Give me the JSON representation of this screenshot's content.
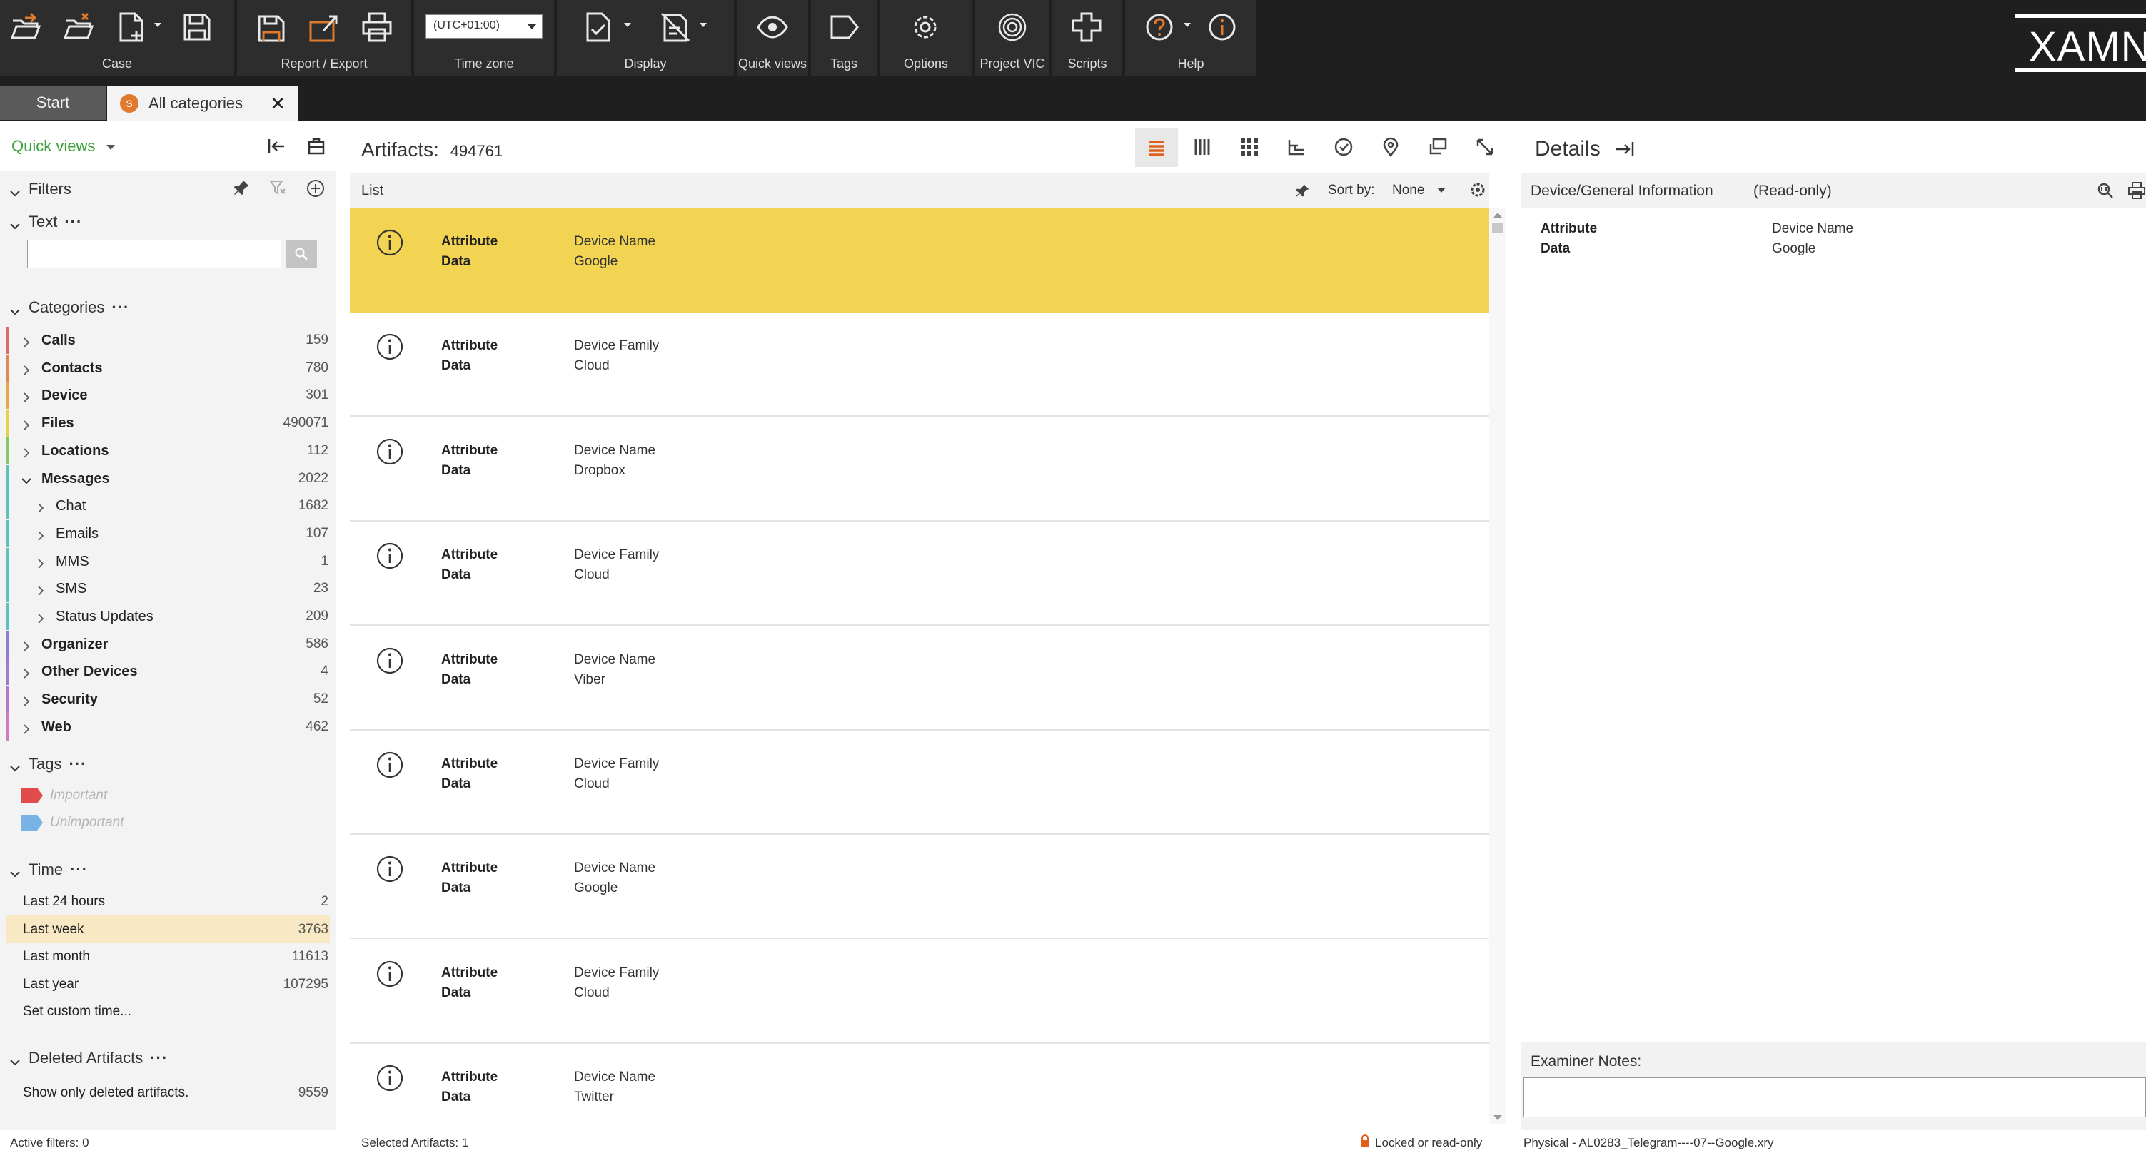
{
  "ribbon": {
    "groups": {
      "case": "Case",
      "report_export": "Report / Export",
      "time_zone": "Time zone",
      "display": "Display",
      "quick_views": "Quick views",
      "tags": "Tags",
      "options": "Options",
      "project_vic": "Project VIC",
      "scripts": "Scripts",
      "help": "Help"
    },
    "timezone_value": "(UTC+01:00)",
    "logo": "XAMN"
  },
  "tabs": {
    "start": "Start",
    "active": "All categories",
    "active_icon_text": "S",
    "close": "✕"
  },
  "left": {
    "quick_views": "Quick views",
    "filters": "Filters",
    "text_section": "Text",
    "search_placeholder": "",
    "categories_title": "Categories",
    "categories": [
      {
        "name": "Calls",
        "count": "159",
        "bold": true,
        "color": "#e06a6a"
      },
      {
        "name": "Contacts",
        "count": "780",
        "bold": true,
        "color": "#e3894f"
      },
      {
        "name": "Device",
        "count": "301",
        "bold": true,
        "color": "#e7a84c"
      },
      {
        "name": "Files",
        "count": "490071",
        "bold": true,
        "color": "#e8d04c"
      },
      {
        "name": "Locations",
        "count": "112",
        "bold": true,
        "color": "#86c76a"
      },
      {
        "name": "Messages",
        "count": "2022",
        "bold": true,
        "color": "#5fc0c0",
        "expanded": true
      },
      {
        "name": "Chat",
        "count": "1682",
        "bold": false,
        "color": "#5fc0c0",
        "child": true
      },
      {
        "name": "Emails",
        "count": "107",
        "bold": false,
        "color": "#5fc0c0",
        "child": true
      },
      {
        "name": "MMS",
        "count": "1",
        "bold": false,
        "color": "#5fc0c0",
        "child": true
      },
      {
        "name": "SMS",
        "count": "23",
        "bold": false,
        "color": "#5fc0c0",
        "child": true
      },
      {
        "name": "Status Updates",
        "count": "209",
        "bold": false,
        "color": "#5fc0c0",
        "child": true
      },
      {
        "name": "Organizer",
        "count": "586",
        "bold": true,
        "color": "#8a7fd6"
      },
      {
        "name": "Other Devices",
        "count": "4",
        "bold": true,
        "color": "#9f7ad0"
      },
      {
        "name": "Security",
        "count": "52",
        "bold": true,
        "color": "#b874cf"
      },
      {
        "name": "Web",
        "count": "462",
        "bold": true,
        "color": "#d47ac4"
      }
    ],
    "tags_title": "Tags",
    "tags": [
      {
        "name": "Important",
        "color": "#e24b4b"
      },
      {
        "name": "Unimportant",
        "color": "#79b3e6"
      }
    ],
    "time_title": "Time",
    "time": [
      {
        "name": "Last 24 hours",
        "count": "2"
      },
      {
        "name": "Last week",
        "count": "3763",
        "highlight": true
      },
      {
        "name": "Last month",
        "count": "11613"
      },
      {
        "name": "Last year",
        "count": "107295"
      },
      {
        "name": "Set custom time...",
        "count": ""
      }
    ],
    "deleted_title": "Deleted Artifacts",
    "deleted_option": "Show only deleted artifacts.",
    "deleted_count": "9559"
  },
  "center": {
    "artifacts_label": "Artifacts:",
    "artifacts_count": "494761",
    "list_label": "List",
    "sort_label": "Sort by:",
    "sort_value": "None",
    "rows": [
      {
        "k1": "Attribute",
        "k2": "Data",
        "v1": "Device Name",
        "v2": "Google",
        "selected": true
      },
      {
        "k1": "Attribute",
        "k2": "Data",
        "v1": "Device Family",
        "v2": "Cloud"
      },
      {
        "k1": "Attribute",
        "k2": "Data",
        "v1": "Device Name",
        "v2": "Dropbox"
      },
      {
        "k1": "Attribute",
        "k2": "Data",
        "v1": "Device Family",
        "v2": "Cloud"
      },
      {
        "k1": "Attribute",
        "k2": "Data",
        "v1": "Device Name",
        "v2": "Viber"
      },
      {
        "k1": "Attribute",
        "k2": "Data",
        "v1": "Device Family",
        "v2": "Cloud"
      },
      {
        "k1": "Attribute",
        "k2": "Data",
        "v1": "Device Name",
        "v2": "Google"
      },
      {
        "k1": "Attribute",
        "k2": "Data",
        "v1": "Device Family",
        "v2": "Cloud"
      },
      {
        "k1": "Attribute",
        "k2": "Data",
        "v1": "Device Name",
        "v2": "Twitter"
      }
    ]
  },
  "details": {
    "title": "Details",
    "subtitle": "Device/General Information",
    "readonly": "(Read-only)",
    "k1": "Attribute",
    "k2": "Data",
    "v1": "Device Name",
    "v2": "Google",
    "examiner_notes": "Examiner Notes:",
    "notes_value": ""
  },
  "status": {
    "active_filters": "Active filters: 0",
    "selected": "Selected Artifacts: 1",
    "locked": "Locked or read-only",
    "source": "Physical - AL0283_Telegram----07--Google.xry"
  },
  "colors": {
    "accent": "#e0601c",
    "selected_row": "#f3d352",
    "quick_views": "#3aa33a"
  }
}
